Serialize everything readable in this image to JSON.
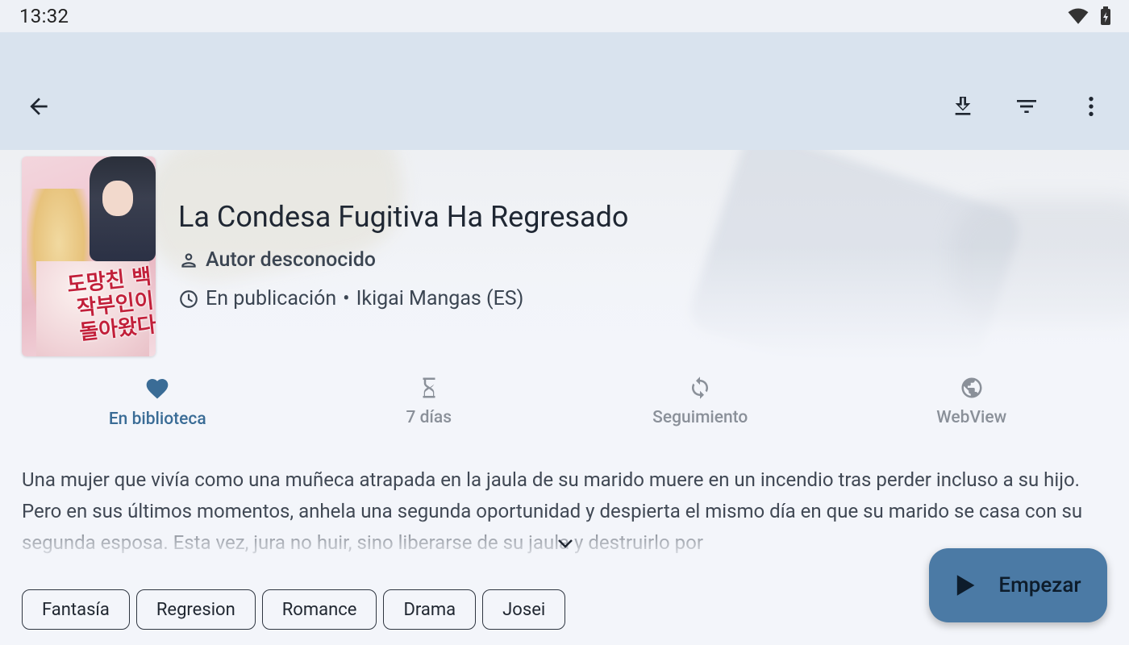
{
  "status_bar": {
    "time": "13:32"
  },
  "manga": {
    "title": "La Condesa Fugitiva Ha Regresado",
    "author": "Autor desconocido",
    "status": "En publicación",
    "source": "Ikigai Mangas (ES)",
    "cover_title": "도망친 백작부인이 돌아왔다"
  },
  "actions": [
    {
      "label": "En biblioteca",
      "icon": "heart-icon",
      "active": true
    },
    {
      "label": "7 días",
      "icon": "hourglass-icon",
      "active": false
    },
    {
      "label": "Seguimiento",
      "icon": "sync-icon",
      "active": false
    },
    {
      "label": "WebView",
      "icon": "globe-icon",
      "active": false
    }
  ],
  "description": "Una mujer que vivía como una muñeca atrapada en la jaula de su marido muere en un incendio tras perder incluso a su hijo. Pero en sus últimos momentos, anhela una segunda oportunidad y despierta el mismo día en que su marido se casa con su segunda esposa. Esta vez, jura no huir, sino liberarse de su jaula y destruirlo por",
  "genres": [
    "Fantasía",
    "Regresion",
    "Romance",
    "Drama",
    "Josei"
  ],
  "fab": {
    "label": "Empezar",
    "icon": "play-icon"
  },
  "colors": {
    "accent": "#3a6c96",
    "fab": "#4b7aa5",
    "toolbar": "#d9e3ee",
    "background": "#f3f5fa"
  }
}
